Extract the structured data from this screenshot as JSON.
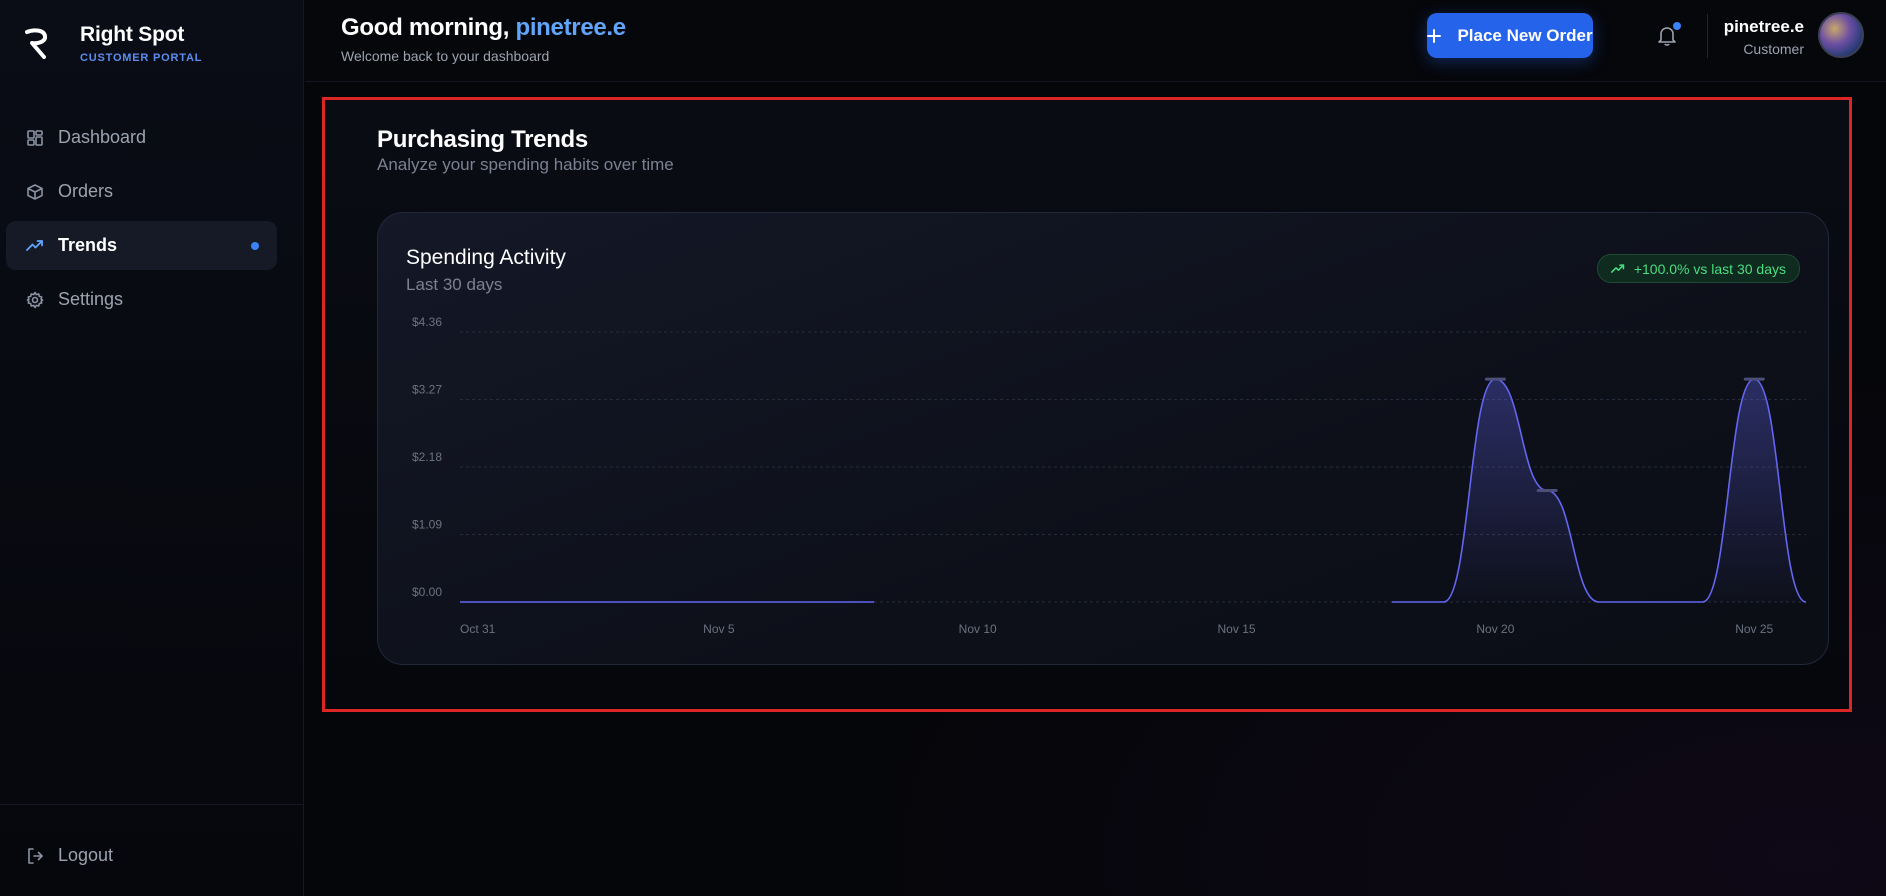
{
  "brand": {
    "name": "Right Spot",
    "subtitle": "CUSTOMER PORTAL"
  },
  "nav": {
    "items": [
      {
        "label": "Dashboard",
        "icon": "grid-icon"
      },
      {
        "label": "Orders",
        "icon": "box-icon"
      },
      {
        "label": "Trends",
        "icon": "trending-up-icon",
        "active": true
      },
      {
        "label": "Settings",
        "icon": "gear-icon"
      }
    ],
    "logout_label": "Logout"
  },
  "header": {
    "greeting": "Good morning,",
    "username": "pinetree.e",
    "subtitle": "Welcome back to your dashboard",
    "order_button_label": "Place New Order"
  },
  "user": {
    "name": "pinetree.e",
    "role": "Customer"
  },
  "section": {
    "title": "Purchasing Trends",
    "subtitle": "Analyze your spending habits over time"
  },
  "card": {
    "title": "Spending Activity",
    "subtitle": "Last 30 days",
    "badge": "+100.0% vs last 30 days"
  },
  "colors": {
    "accent": "#2563eb",
    "link": "#60a5fa",
    "line": "#6366f1",
    "positive": "#4ade80",
    "highlight_border": "#dc2626"
  },
  "chart_data": {
    "type": "area",
    "x": [
      "Oct 31",
      "Nov 1",
      "Nov 2",
      "Nov 3",
      "Nov 4",
      "Nov 5",
      "Nov 6",
      "Nov 7",
      "Nov 8",
      "Nov 9",
      "Nov 10",
      "Nov 11",
      "Nov 12",
      "Nov 13",
      "Nov 14",
      "Nov 15",
      "Nov 16",
      "Nov 17",
      "Nov 18",
      "Nov 19",
      "Nov 20",
      "Nov 21",
      "Nov 22",
      "Nov 23",
      "Nov 24",
      "Nov 25",
      "Nov 26"
    ],
    "y": [
      0,
      0,
      0,
      0,
      0,
      0,
      0,
      0,
      0,
      null,
      null,
      null,
      null,
      null,
      null,
      null,
      null,
      null,
      0,
      0,
      3.6,
      1.8,
      0,
      0,
      0,
      3.6,
      0
    ],
    "x_ticks": [
      "Oct 31",
      "Nov 5",
      "Nov 10",
      "Nov 15",
      "Nov 20",
      "Nov 25"
    ],
    "y_ticks": [
      "$0.00",
      "$1.09",
      "$2.18",
      "$3.27",
      "$4.36"
    ],
    "ylim": [
      0,
      4.36
    ],
    "grid": true,
    "xlabel": "",
    "ylabel": ""
  }
}
